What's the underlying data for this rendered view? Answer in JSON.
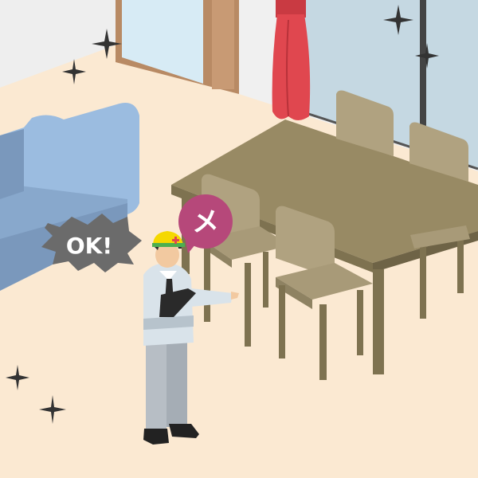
{
  "ok_bubble": {
    "label": "OK!"
  },
  "x_bubble": {
    "label": "メ"
  },
  "colors": {
    "floor": "#fbe9d2",
    "wall": "#eeeeee",
    "sofa": "#8eb0d8",
    "table": "#988a64",
    "chair": "#b0a280",
    "curtain": "#e0474f",
    "ok_bubble": "#6b6b6b",
    "x_bubble": "#b6487a",
    "helmet": "#f5d800"
  },
  "icons": [
    "sparkle-icon",
    "ng-x-icon"
  ]
}
